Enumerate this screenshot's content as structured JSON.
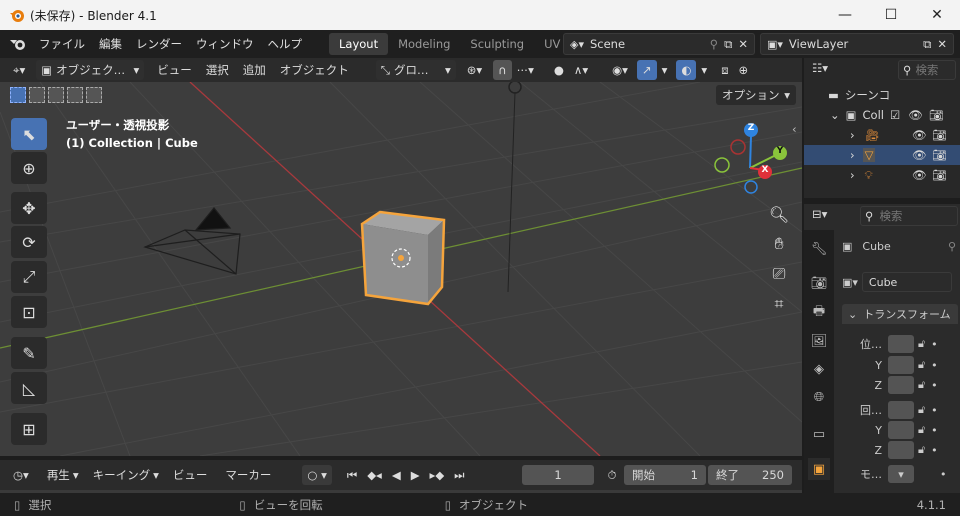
{
  "window": {
    "title": "(未保存) - Blender 4.1",
    "minimize": "—",
    "maximize": "☐",
    "close": "✕"
  },
  "menu": [
    "ファイル",
    "編集",
    "レンダー",
    "ウィンドウ",
    "ヘルプ"
  ],
  "workspaces": [
    "Layout",
    "Modeling",
    "Sculpting",
    "UV Ed"
  ],
  "scene": {
    "label": "Scene"
  },
  "viewlayer": {
    "label": "ViewLayer"
  },
  "viewport_header": {
    "mode": "オブジェク…",
    "menus": [
      "ビュー",
      "選択",
      "追加",
      "オブジェクト"
    ],
    "transform_orientation": "グロ…",
    "options": "オプション"
  },
  "viewport": {
    "view_name": "ユーザー・透視投影",
    "collection_info": "(1) Collection | Cube",
    "gizmo": {
      "z": "Z",
      "y": "Y",
      "x": "X"
    }
  },
  "outliner": {
    "search_placeholder": "検索",
    "scene_label": "シーンコ",
    "collection_label": "Coll"
  },
  "properties": {
    "search_placeholder": "検索",
    "object_name": "Cube",
    "data_name": "Cube",
    "transform_panel": "トランスフォーム",
    "location_label": "位…",
    "rotation_label": "回…",
    "mode_label": "モ…",
    "y": "Y",
    "z": "Z"
  },
  "timeline": {
    "playback": "再生",
    "keying": "キーイング",
    "view": "ビュー",
    "marker": "マーカー",
    "current_frame": "1",
    "start_label": "開始",
    "start_value": "1",
    "end_label": "終了",
    "end_value": "250"
  },
  "statusbar": {
    "select": "選択",
    "rotate": "ビューを回転",
    "object": "オブジェクト",
    "version": "4.1.1"
  },
  "colors": {
    "accent": "#4772b3",
    "selection": "#f5a43c",
    "x_axis": "#e0303a",
    "y_axis": "#8ac43b",
    "z_axis": "#2f84e0"
  }
}
